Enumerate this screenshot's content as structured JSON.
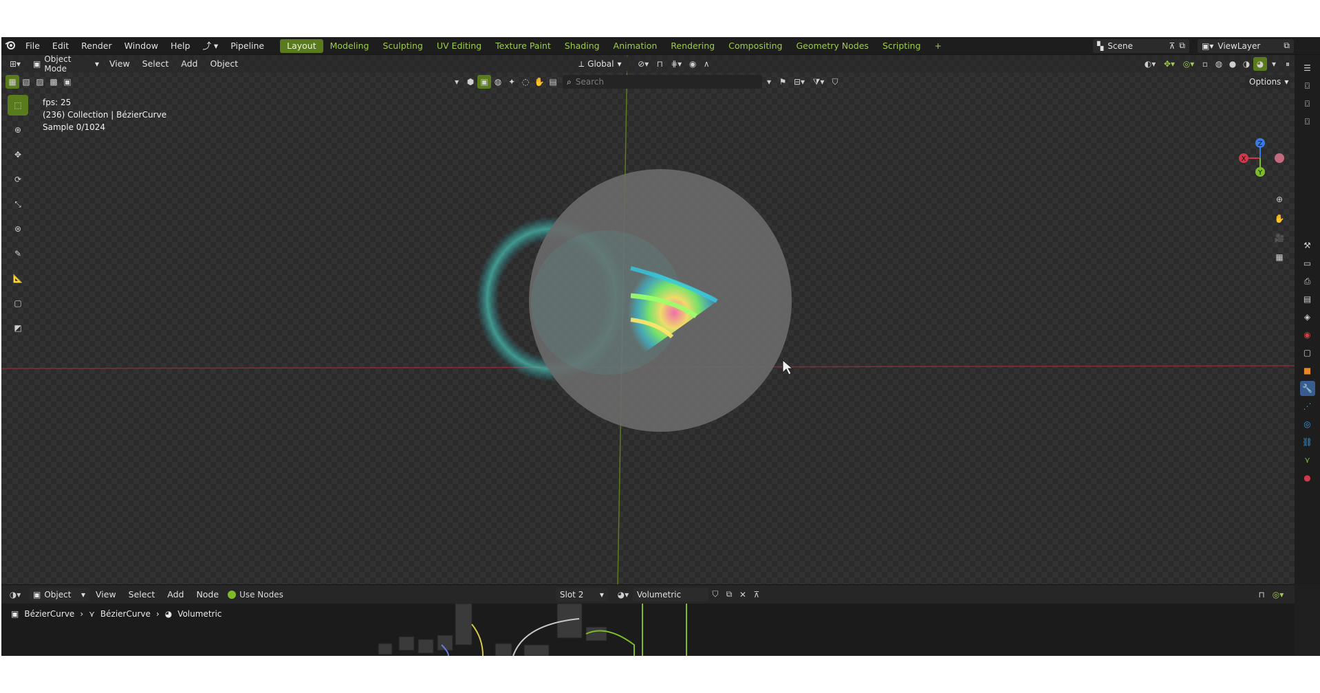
{
  "topbar": {
    "menus": [
      "File",
      "Edit",
      "Render",
      "Window",
      "Help"
    ],
    "pipeline": "Pipeline",
    "workspaces": [
      "Layout",
      "Modeling",
      "Sculpting",
      "UV Editing",
      "Texture Paint",
      "Shading",
      "Animation",
      "Rendering",
      "Compositing",
      "Geometry Nodes",
      "Scripting"
    ],
    "active_workspace": "Layout",
    "add_tab": "+",
    "scene": "Scene",
    "view_layer": "ViewLayer"
  },
  "viewport_header": {
    "mode": "Object Mode",
    "menus": [
      "View",
      "Select",
      "Add",
      "Object"
    ],
    "orientation": "Global",
    "options": "Options",
    "search_placeholder": "Search"
  },
  "overlay": {
    "fps": "fps: 25",
    "collection": "(236) Collection | BézierCurve",
    "sample": "Sample 0/1024"
  },
  "gizmo": {
    "z": "Z",
    "x": "X",
    "y": "Y"
  },
  "node_editor": {
    "editor_type": "Object",
    "menus": [
      "View",
      "Select",
      "Add",
      "Node"
    ],
    "use_nodes": "Use Nodes",
    "slot": "Slot 2",
    "material": "Volumetric",
    "breadcrumb": [
      "BézierCurve",
      "BézierCurve",
      "Volumetric"
    ]
  },
  "colors": {
    "accent": "#5a7a1e",
    "workspace_text": "#9fca52",
    "axis_red": "#b0303a",
    "axis_green": "#6a8a1e"
  }
}
